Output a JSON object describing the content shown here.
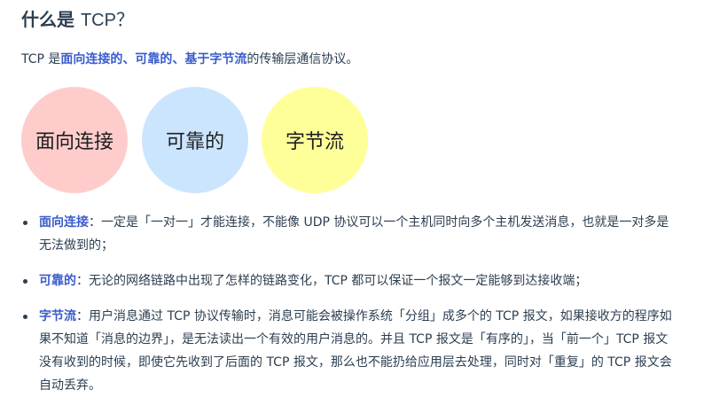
{
  "heading": {
    "prefix": "什么是 ",
    "term": "TCP",
    "suffix": "？"
  },
  "intro": {
    "before": "TCP 是",
    "highlight": "面向连接的、可靠的、基于字节流",
    "after": "的传输层通信协议。"
  },
  "circles": [
    {
      "label": "面向连接",
      "color": "#ffcccc"
    },
    {
      "label": "可靠的",
      "color": "#cce5ff"
    },
    {
      "label": "字节流",
      "color": "#ffff99"
    }
  ],
  "bullets": [
    {
      "term": "面向连接",
      "text": "：一定是「一对一」才能连接，不能像 UDP 协议可以一个主机同时向多个主机发送消息，也就是一对多是无法做到的；"
    },
    {
      "term": "可靠的",
      "text": "：无论的网络链路中出现了怎样的链路变化，TCP 都可以保证一个报文一定能够到达接收端；"
    },
    {
      "term": "字节流",
      "text": "：用户消息通过 TCP 协议传输时，消息可能会被操作系统「分组」成多个的 TCP 报文，如果接收方的程序如果不知道「消息的边界」，是无法读出一个有效的用户消息的。并且 TCP 报文是「有序的」，当「前一个」TCP 报文没有收到的时候，即使它先收到了后面的 TCP 报文，那么也不能扔给应用层去处理，同时对「重复」的 TCP 报文会自动丢弃。"
    }
  ]
}
